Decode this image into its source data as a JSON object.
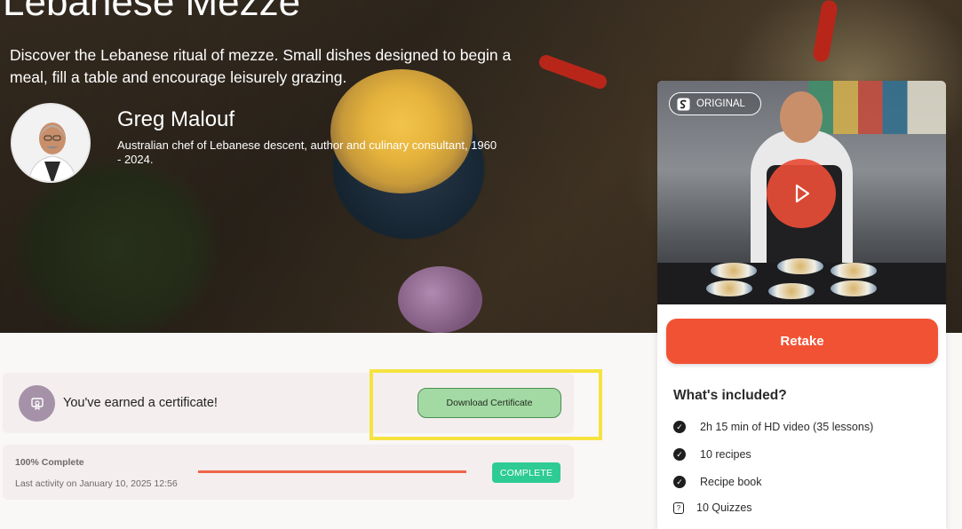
{
  "hero": {
    "title": "Lebanese Mezze",
    "description": "Discover the Lebanese ritual of mezze. Small dishes designed to begin a meal, fill a table and encourage leisurely grazing.",
    "chef": {
      "name": "Greg Malouf",
      "bio": "Australian chef of Lebanese descent, author and culinary consultant, 1960 - 2024."
    }
  },
  "certificate": {
    "message": "You've earned a certificate!",
    "download_label": "Download Certificate"
  },
  "progress": {
    "percent_label": "100% Complete",
    "percent_value": 1.0,
    "last_activity": "Last activity on January 10, 2025 12:56",
    "status_badge": "COMPLETE"
  },
  "panel": {
    "badge_label": "ORIGINAL",
    "retake_label": "Retake",
    "included_title": "What's included?",
    "included": [
      {
        "icon": "check-circle-icon",
        "label": "2h 15 min of HD video (35 lessons)"
      },
      {
        "icon": "check-circle-icon",
        "label": "10 recipes"
      },
      {
        "icon": "check-circle-icon",
        "label": "Recipe book"
      },
      {
        "icon": "quiz-icon",
        "label": "10 Quizzes"
      }
    ]
  },
  "colors": {
    "accent": "#f25234",
    "progress": "#ee6548",
    "complete": "#2ecb95",
    "highlight": "#f5e33f",
    "download": "#a3d9a3"
  }
}
